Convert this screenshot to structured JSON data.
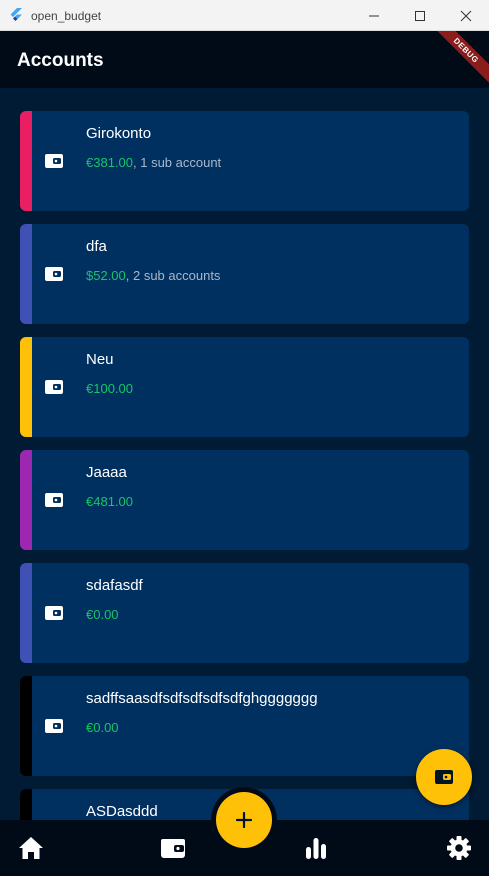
{
  "window": {
    "title": "open_budget"
  },
  "appbar": {
    "title": "Accounts",
    "debug_label": "DEBUG"
  },
  "accounts": [
    {
      "name": "Girokonto",
      "amount": "€381.00",
      "sub": ", 1 sub account",
      "color": "#e91e63"
    },
    {
      "name": "dfa",
      "amount": "$52.00",
      "sub": ", 2 sub accounts",
      "color": "#3f51b5"
    },
    {
      "name": "Neu",
      "amount": "€100.00",
      "sub": "",
      "color": "#ffc107"
    },
    {
      "name": "Jaaaa",
      "amount": "€481.00",
      "sub": "",
      "color": "#9c27b0"
    },
    {
      "name": "sdafasdf",
      "amount": "€0.00",
      "sub": "",
      "color": "#3f51b5"
    },
    {
      "name": "sadffsaasdfsdfsdfsdfsdfghggggggg",
      "amount": "€0.00",
      "sub": "",
      "color": "#000000"
    },
    {
      "name": "ASDasddd",
      "amount": "",
      "sub": "",
      "color": "#000000"
    }
  ],
  "colors": {
    "accent": "#ffc107",
    "card": "#003060",
    "amount": "#18c46a"
  },
  "fab": {
    "icon": "wallet-icon"
  },
  "center_fab": {
    "icon": "plus-icon"
  },
  "bottom_nav": [
    "home-icon",
    "wallet-icon",
    "bar-chart-icon",
    "gear-icon"
  ]
}
